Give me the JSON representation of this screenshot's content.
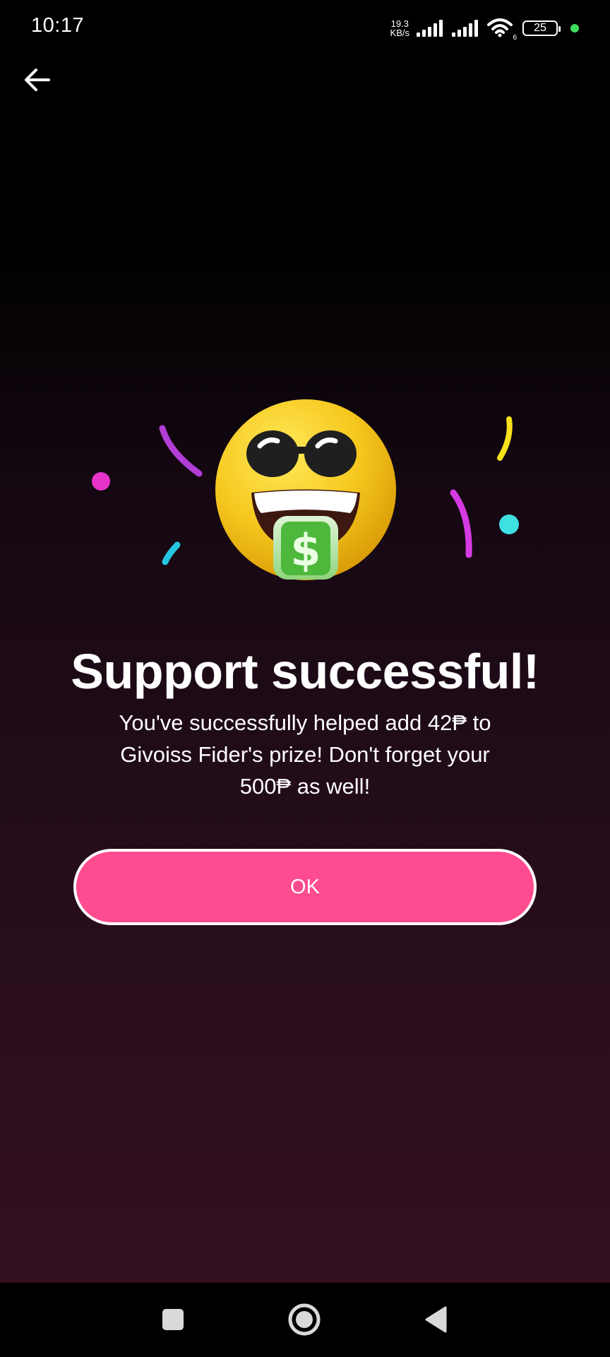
{
  "status_bar": {
    "time": "10:17",
    "net_speed_value": "19.3",
    "net_speed_unit": "KB/s",
    "wifi_badge": "6",
    "battery_level": "25",
    "charge_dot_color": "#3ddc5a"
  },
  "main": {
    "title": "Support successful!",
    "message": "You've successfully helped add 42₱ to Givoiss Fider's prize! Don't forget your 500₱ as well!",
    "ok_label": "OK",
    "accent_color": "#ff4b8f"
  },
  "icons": {
    "back": "arrow-left-icon",
    "illustration": "money-mouth-sunglasses-emoji",
    "nav_recents": "square-icon",
    "nav_home": "circle-icon",
    "nav_back": "triangle-icon"
  }
}
